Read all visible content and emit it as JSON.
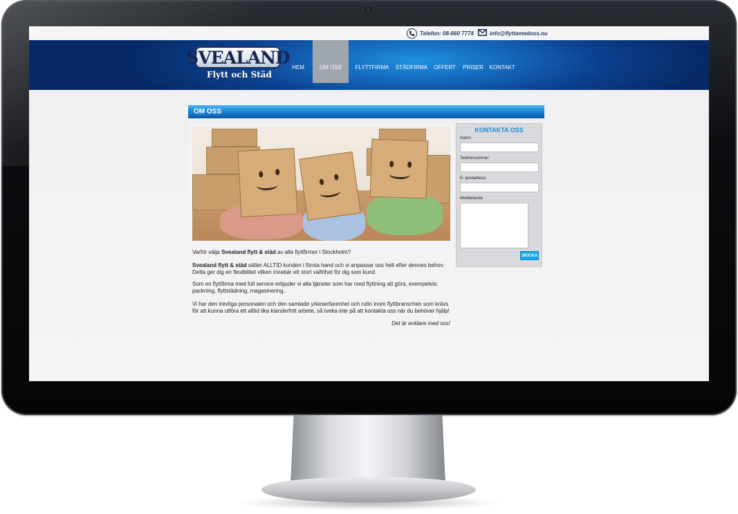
{
  "topbar": {
    "phone": "Telefon: 08-660 7774",
    "email": "info@flyttamedoss.nu"
  },
  "logo": {
    "name": "SVEALAND",
    "tagline": "Flytt och Städ"
  },
  "nav": {
    "items": [
      {
        "label": "HEM",
        "active": false
      },
      {
        "label": "OM OSS",
        "active": true
      },
      {
        "label": "FLYTTFIRMA",
        "active": false
      },
      {
        "label": "STÄDFIRMA",
        "active": false
      },
      {
        "label": "OFFERT",
        "active": false
      },
      {
        "label": "PRISER",
        "active": false
      },
      {
        "label": "KONTAKT",
        "active": false
      }
    ]
  },
  "page": {
    "title": "OM OSS"
  },
  "content": {
    "intro_pre": "Varför välja ",
    "intro_bold": "Svealand flytt & städ",
    "intro_post": " av alla flyttfirmor i Stockholm?",
    "p1_bold": "Svealand flytt & städ",
    "p1_text": " sätter ALLTID kunden i första hand och vi anpassar oss helt efter dennes behov. Detta ger dig en flexibilitet vilken innebär ett stort valfrihet för dig som kund.",
    "p2": "Som en flyttfirma med full service erbjuder vi alla tjänster som har med flyttning att göra, exempelvis:  packning, flyttstädning, magasinering..",
    "p3": "Vi har den trevliga personalen och den samlade yrkeserfarenhet och rutin inom flyttbranschen som krävs för att kunna utföra ett alltid lika klanderfritt arbete, så tveka inte på att kontakta oss när du behöver hjälp!",
    "sign": "Det är enklare med oss!"
  },
  "contact_form": {
    "title": "KONTAKTA OSS",
    "name_label": "Namn",
    "phone_label": "Telefonnummer:",
    "email_label": "E- postadress:",
    "message_label": "Meddelande",
    "submit_label": "SKICKA"
  },
  "colors": {
    "accent": "#1e8ad6",
    "header_blue": "#0b3e8c",
    "button": "#16a7ea"
  },
  "icons": {
    "phone": "phone-icon",
    "mail": "mail-icon"
  }
}
